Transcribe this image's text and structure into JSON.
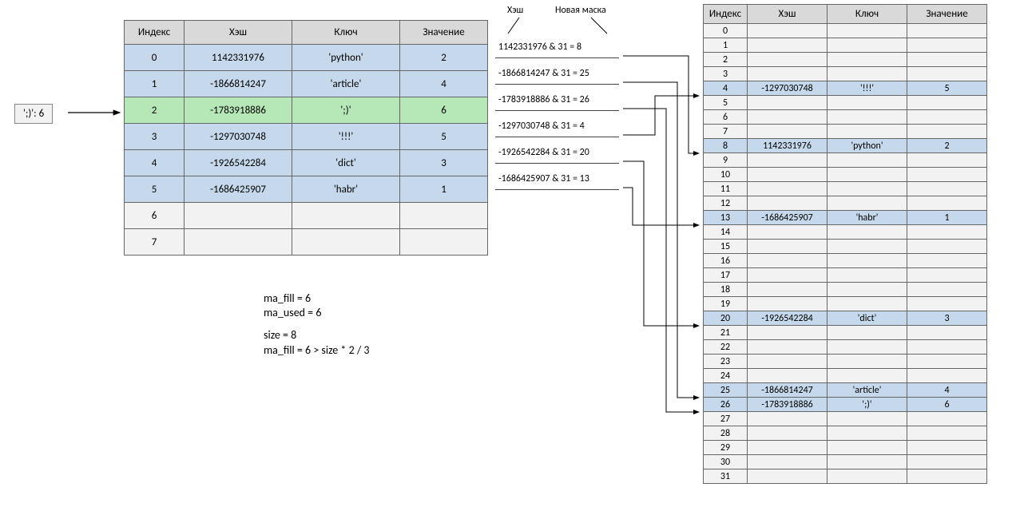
{
  "input_label": "';)': 6",
  "left_table": {
    "headers": {
      "index": "Индекс",
      "hash": "Хэш",
      "key": "Ключ",
      "value": "Значение"
    },
    "rows": [
      {
        "idx": "0",
        "hash": "1142331976",
        "key": "'python'",
        "val": "2",
        "cls": "blue"
      },
      {
        "idx": "1",
        "hash": "-1866814247",
        "key": "'article'",
        "val": "4",
        "cls": "blue"
      },
      {
        "idx": "2",
        "hash": "-1783918886",
        "key": "';)'",
        "val": "6",
        "cls": "green"
      },
      {
        "idx": "3",
        "hash": "-1297030748",
        "key": "'!!!'",
        "val": "5",
        "cls": "blue"
      },
      {
        "idx": "4",
        "hash": "-1926542284",
        "key": "'dict'",
        "val": "3",
        "cls": "blue"
      },
      {
        "idx": "5",
        "hash": "-1686425907",
        "key": "'habr'",
        "val": "1",
        "cls": "blue"
      },
      {
        "idx": "6",
        "hash": "",
        "key": "",
        "val": "",
        "cls": "empty"
      },
      {
        "idx": "7",
        "hash": "",
        "key": "",
        "val": "",
        "cls": "empty"
      }
    ]
  },
  "right_table": {
    "headers": {
      "index": "Индекс",
      "hash": "Хэш",
      "key": "Ключ",
      "value": "Значение"
    },
    "size": 32,
    "filled": {
      "4": {
        "hash": "-1297030748",
        "key": "'!!!'",
        "val": "5"
      },
      "8": {
        "hash": "1142331976",
        "key": "'python'",
        "val": "2"
      },
      "13": {
        "hash": "-1686425907",
        "key": "'habr'",
        "val": "1"
      },
      "20": {
        "hash": "-1926542284",
        "key": "'dict'",
        "val": "3"
      },
      "25": {
        "hash": "-1866814247",
        "key": "'article'",
        "val": "4"
      },
      "26": {
        "hash": "-1783918886",
        "key": "';)'",
        "val": "6"
      }
    }
  },
  "calc_labels": {
    "hash": "Хэш",
    "mask": "Новая маска"
  },
  "hash_calcs": [
    "1142331976 & 31 = 8",
    "-1866814247 & 31 = 25",
    "-1783918886 & 31 = 26",
    "-1297030748 & 31 = 4",
    "-1926542284 & 31 = 20",
    "-1686425907 & 31 = 13"
  ],
  "stats": {
    "line1": "ma_fill = 6",
    "line2": "ma_used = 6",
    "line3": "size = 8",
    "line4": "ma_fill = 6 > size * 2 / 3"
  }
}
